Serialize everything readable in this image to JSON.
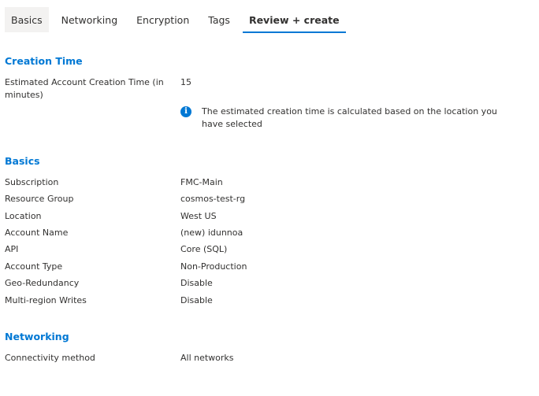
{
  "tabs": [
    {
      "label": "Basics",
      "state": "hovered"
    },
    {
      "label": "Networking",
      "state": "normal"
    },
    {
      "label": "Encryption",
      "state": "normal"
    },
    {
      "label": "Tags",
      "state": "normal"
    },
    {
      "label": "Review + create",
      "state": "active"
    }
  ],
  "creation_time": {
    "title": "Creation Time",
    "rows": [
      {
        "label": "Estimated Account Creation Time (in minutes)",
        "value": "15"
      }
    ],
    "info_icon": "info-icon",
    "info_text": "The estimated creation time is calculated based on the location you have selected"
  },
  "basics": {
    "title": "Basics",
    "rows": [
      {
        "label": "Subscription",
        "value": "FMC-Main"
      },
      {
        "label": "Resource Group",
        "value": "cosmos-test-rg"
      },
      {
        "label": "Location",
        "value": "West US"
      },
      {
        "label": "Account Name",
        "value": "(new) idunnoa"
      },
      {
        "label": "API",
        "value": "Core (SQL)"
      },
      {
        "label": "Account Type",
        "value": "Non-Production"
      },
      {
        "label": "Geo-Redundancy",
        "value": "Disable"
      },
      {
        "label": "Multi-region Writes",
        "value": "Disable"
      }
    ]
  },
  "networking": {
    "title": "Networking",
    "rows": [
      {
        "label": "Connectivity method",
        "value": "All networks"
      }
    ]
  },
  "colors": {
    "accent": "#0078d4",
    "text": "#323130",
    "tab_hover_bg": "#f3f2f1"
  }
}
